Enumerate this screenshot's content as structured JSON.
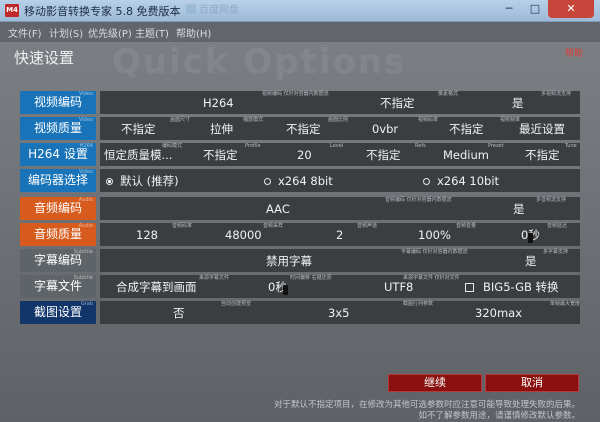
{
  "window": {
    "title": "移动影音转换专家 5.8 免费版本",
    "icon_text": "M4",
    "bg_tab": "百度网盘",
    "min_glyph": "─",
    "max_glyph": "□",
    "close_glyph": "✕"
  },
  "menu": [
    {
      "label": "文件(F)"
    },
    {
      "label": "计划(S)"
    },
    {
      "label": "优先级(P)"
    },
    {
      "label": "主题(T)"
    },
    {
      "label": "帮助(H)"
    }
  ],
  "page": {
    "title": "快速设置",
    "watermark": "Quick Options",
    "help": "帮助"
  },
  "rows": {
    "video_codec": {
      "label": "视频编码",
      "en": "Video",
      "v1": "H264",
      "v2": "不指定",
      "v3": "是",
      "s1": "视频编码 仅针对容器内数据流",
      "s2": "像素格式",
      "s3": "多视频流支持"
    },
    "video_quality": {
      "label": "视频质量",
      "en": "Video",
      "v1": "不指定",
      "v2": "拉伸",
      "v3": "不指定",
      "v4": "0vbr",
      "v5": "不指定",
      "v6": "最近设置",
      "s1": "画面尺寸",
      "s2": "缩放模式",
      "s3": "画面比例",
      "s4": "视频码率",
      "s5": "视频帧率"
    },
    "h264": {
      "label": "H264 设置",
      "en": "H264",
      "v1": "恒定质量模...",
      "v2": "不指定",
      "v3": "20",
      "v4": "不指定",
      "v5": "Medium",
      "v6": "不指定",
      "s1": "编码模式",
      "s2": "Profile",
      "s3": "Level",
      "s4": "Refs",
      "s5": "Preset",
      "s6": "Tune"
    },
    "encoder": {
      "label": "编码器选择",
      "en": "Video",
      "opt1": "默认 (推荐)",
      "opt2": "x264 8bit",
      "opt3": "x264 10bit"
    },
    "audio_codec": {
      "label": "音频编码",
      "en": "Audio",
      "v1": "AAC",
      "v2": "是",
      "s1": "音频编码 仅针对容器内数据流",
      "s2": "多音频流支持"
    },
    "audio_quality": {
      "label": "音频质量",
      "en": "Audio",
      "v1": "128",
      "v2": "48000",
      "v3": "2",
      "v4": "100%",
      "v5": "0秒",
      "s1": "音频码率",
      "s2": "音频采样",
      "s3": "音频声道",
      "s4": "音频音量",
      "s5": "音频延迟"
    },
    "subtitle_codec": {
      "label": "字幕编码",
      "en": "Subtitle",
      "v1": "禁用字幕",
      "v2": "是",
      "s1": "字幕编码 仅针对容器内数据流",
      "s2": "多字幕支持"
    },
    "subtitle_file": {
      "label": "字幕文件",
      "en": "Subtitle",
      "v1": "合成字幕到画面",
      "v2": "0秒",
      "v3": "UTF8",
      "v4": "BIG5-GB 转换",
      "s1": "来源字幕文件",
      "s2": "时间偏移 右键还原",
      "s3": "来源字幕文件 仅针对文件"
    },
    "capture": {
      "label": "截图设置",
      "en": "Grab",
      "v1": "否",
      "v2": "3x5",
      "v3": "320max",
      "s1": "自动创建预览",
      "s2": "截图行列参数",
      "s3": "单帧最大宽度"
    }
  },
  "buttons": {
    "continue": "继续",
    "cancel": "取消"
  },
  "notes": {
    "line1": "对于默认不指定项目，在修改为其他可选参数时应注意可能导致处理失败的后果。",
    "line2": "如不了解参数用途，请谨慎修改默认参数。"
  },
  "colors": {
    "blue_label": "#1873b9",
    "orange_label": "#d65b1d",
    "gray_label": "#5f6468",
    "navy_label": "#12356a",
    "button_red": "#8a1010",
    "help_red": "#e03b2e"
  }
}
